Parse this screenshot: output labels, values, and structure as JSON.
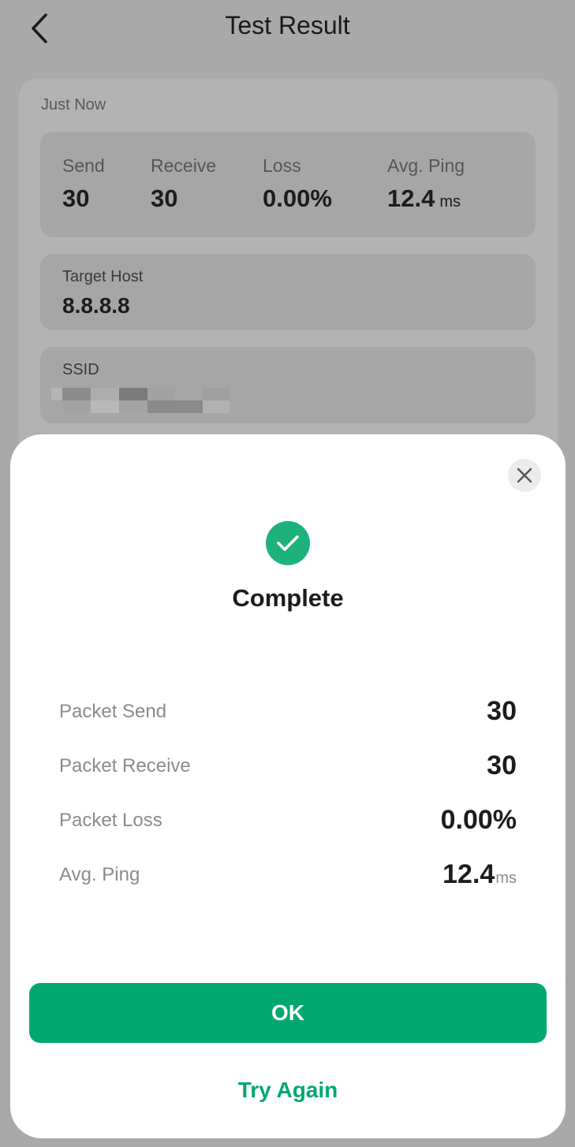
{
  "nav": {
    "title": "Test Result"
  },
  "card": {
    "time": "Just Now",
    "stats": [
      {
        "label": "Send",
        "value": "30",
        "unit": ""
      },
      {
        "label": "Receive",
        "value": "30",
        "unit": ""
      },
      {
        "label": "Loss",
        "value": "0.00%",
        "unit": ""
      },
      {
        "label": "Avg. Ping",
        "value": "12.4",
        "unit": "ms"
      }
    ],
    "target_host": {
      "label": "Target Host",
      "value": "8.8.8.8"
    },
    "ssid": {
      "label": "SSID"
    }
  },
  "dialog": {
    "title": "Complete",
    "rows": [
      {
        "label": "Packet Send",
        "value": "30",
        "unit": ""
      },
      {
        "label": "Packet Receive",
        "value": "30",
        "unit": ""
      },
      {
        "label": "Packet Loss",
        "value": "0.00%",
        "unit": ""
      },
      {
        "label": "Avg. Ping",
        "value": "12.4",
        "unit": "ms"
      }
    ],
    "ok_label": "OK",
    "try_again_label": "Try Again"
  },
  "colors": {
    "accent": "#00a870",
    "check": "#1db27c",
    "overlay_bg": "#a9a9a9"
  },
  "icons": {
    "back": "chevron-left-icon",
    "close": "close-icon",
    "status": "check-circle-icon"
  }
}
